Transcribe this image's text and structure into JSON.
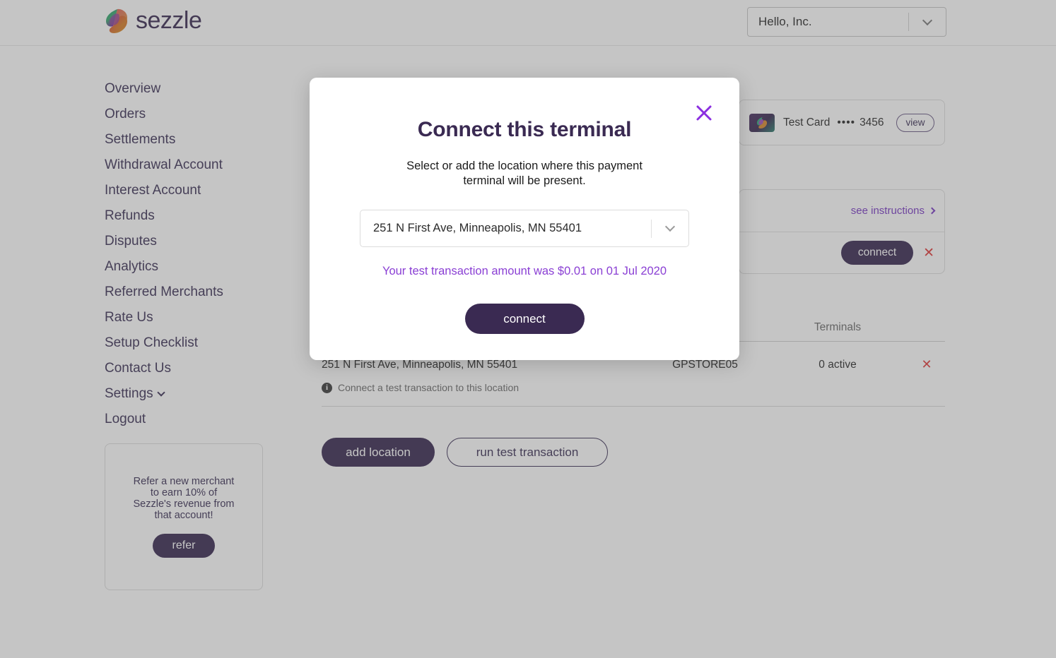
{
  "header": {
    "logo_text": "sezzle",
    "merchant_name": "Hello, Inc.",
    "merchant_caret_icon": "chevron-down-icon"
  },
  "sidebar": {
    "items": [
      {
        "label": "Overview"
      },
      {
        "label": "Orders"
      },
      {
        "label": "Settlements"
      },
      {
        "label": "Withdrawal Account"
      },
      {
        "label": "Interest Account"
      },
      {
        "label": "Refunds"
      },
      {
        "label": "Disputes"
      },
      {
        "label": "Analytics"
      },
      {
        "label": "Referred Merchants"
      },
      {
        "label": "Rate Us"
      },
      {
        "label": "Setup Checklist"
      },
      {
        "label": "Contact Us"
      },
      {
        "label": "Settings",
        "has_chevron": true
      },
      {
        "label": "Logout"
      }
    ],
    "refer_card": {
      "text": "Refer a new merchant to earn 10% of Sezzle's revenue from that account!",
      "button_label": "refer"
    }
  },
  "payment_card": {
    "icon": "sezzle-card-icon",
    "label": "Test Card",
    "dots": "••••",
    "last4": "3456",
    "view_label": "view"
  },
  "terminal_card": {
    "instructions_label": "see instructions",
    "instructions_icon": "chevron-right-icon",
    "connect_label": "connect",
    "delete_icon": "close-icon"
  },
  "locations_table": {
    "columns": {
      "address": "",
      "code": "",
      "terminals": "Terminals",
      "remove": ""
    },
    "rows": [
      {
        "address": "251 N First Ave, Minneapolis, MN 55401",
        "code": "GPSTORE05",
        "terminals": "0 active",
        "remove_icon": "✕"
      }
    ],
    "hint": {
      "icon": "info-icon",
      "text": "Connect a test transaction to this location"
    }
  },
  "actions": {
    "add_location_label": "add location",
    "run_test_label": "run test transaction"
  },
  "modal": {
    "title": "Connect this terminal",
    "subtitle": "Select or add the location where this payment terminal will be present.",
    "close_icon": "close-icon",
    "select": {
      "value": "251 N First Ave, Minneapolis, MN 55401",
      "caret_icon": "chevron-down-icon"
    },
    "note": "Your test transaction amount was $0.01 on 01 Jul 2020",
    "connect_label": "connect"
  },
  "colors": {
    "brand_purple": "#3a2a52",
    "accent_purple": "#8a3fd4",
    "link_purple": "#7a3bc4",
    "danger_red": "#e03a3a"
  }
}
